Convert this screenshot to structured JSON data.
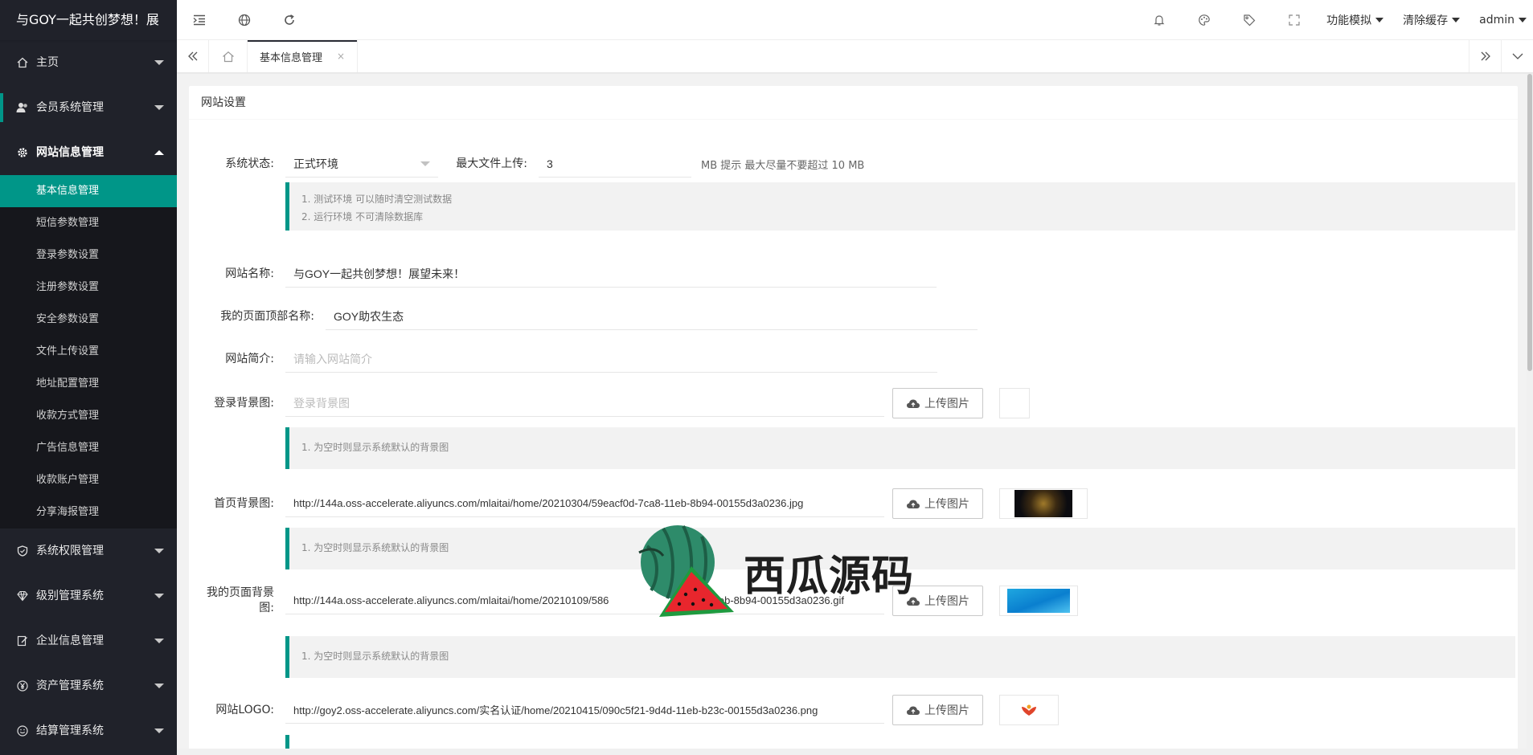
{
  "app": {
    "logo_text": "与GOY一起共创梦想！展"
  },
  "sidebar": {
    "groups_top": [
      {
        "label": "主页",
        "icon": "home-icon"
      },
      {
        "label": "会员系统管理",
        "icon": "users-icon"
      },
      {
        "label": "网站信息管理",
        "icon": "gear-icon"
      }
    ],
    "submenu": [
      "基本信息管理",
      "短信参数管理",
      "登录参数设置",
      "注册参数设置",
      "安全参数设置",
      "文件上传设置",
      "地址配置管理",
      "收款方式管理",
      "广告信息管理",
      "收款账户管理",
      "分享海报管理"
    ],
    "groups_bottom": [
      {
        "label": "系统权限管理",
        "icon": "shield-icon"
      },
      {
        "label": "级别管理系统",
        "icon": "diamond-icon"
      },
      {
        "label": "企业信息管理",
        "icon": "edit-icon"
      },
      {
        "label": "资产管理系统",
        "icon": "yen-icon"
      },
      {
        "label": "结算管理系统",
        "icon": "smile-icon"
      }
    ]
  },
  "header": {
    "menus": [
      "功能模拟",
      "清除缓存",
      "admin"
    ]
  },
  "tabs": {
    "active_label": "基本信息管理",
    "close_glyph": "×"
  },
  "card": {
    "title": "网站设置"
  },
  "form": {
    "status_label": "系统状态:",
    "status_value": "正式环境",
    "maxfile_label": "最大文件上传:",
    "maxfile_value": "3",
    "maxfile_hint": "MB 提示 最大尽量不要超过 10 MB",
    "env_tips": [
      "1. 测试环境 可以随时清空测试数据",
      "2. 运行环境 不可清除数据库"
    ],
    "site_name_label": "网站名称:",
    "site_name_value": "与GOY一起共创梦想！展望未来！",
    "mypage_title_label": "我的页面顶部名称:",
    "mypage_title_value": "GOY助农生态",
    "intro_label": "网站简介:",
    "intro_placeholder": "请输入网站简介",
    "login_bg_label": "登录背景图:",
    "login_bg_placeholder": "登录背景图",
    "bg_tip": "1. 为空时则显示系统默认的背景图",
    "home_bg_label": "首页背景图:",
    "home_bg_value": "http://144a.oss-accelerate.aliyuncs.com/mlaitai/home/20210304/59eacf0d-7ca8-11eb-8b94-00155d3a0236.jpg",
    "mypage_bg_label_1": "我的页面背景",
    "mypage_bg_label_2": "图:",
    "mypage_bg_value": "http://144a.oss-accelerate.aliyuncs.com/mlaitai/home/20210109/586",
    "mypage_bg_value_tail": "1eb-8b94-00155d3a0236.gif",
    "logo_label": "网站LOGO:",
    "logo_value": "http://goy2.oss-accelerate.aliyuncs.com/实名认证/home/20210415/090c5f21-9d4d-11eb-b23c-00155d3a0236.png",
    "upload_label": "上传图片"
  },
  "watermark": {
    "text": "西瓜源码"
  },
  "colors": {
    "sidebar_bg": "#20222a",
    "accent": "#009688"
  }
}
